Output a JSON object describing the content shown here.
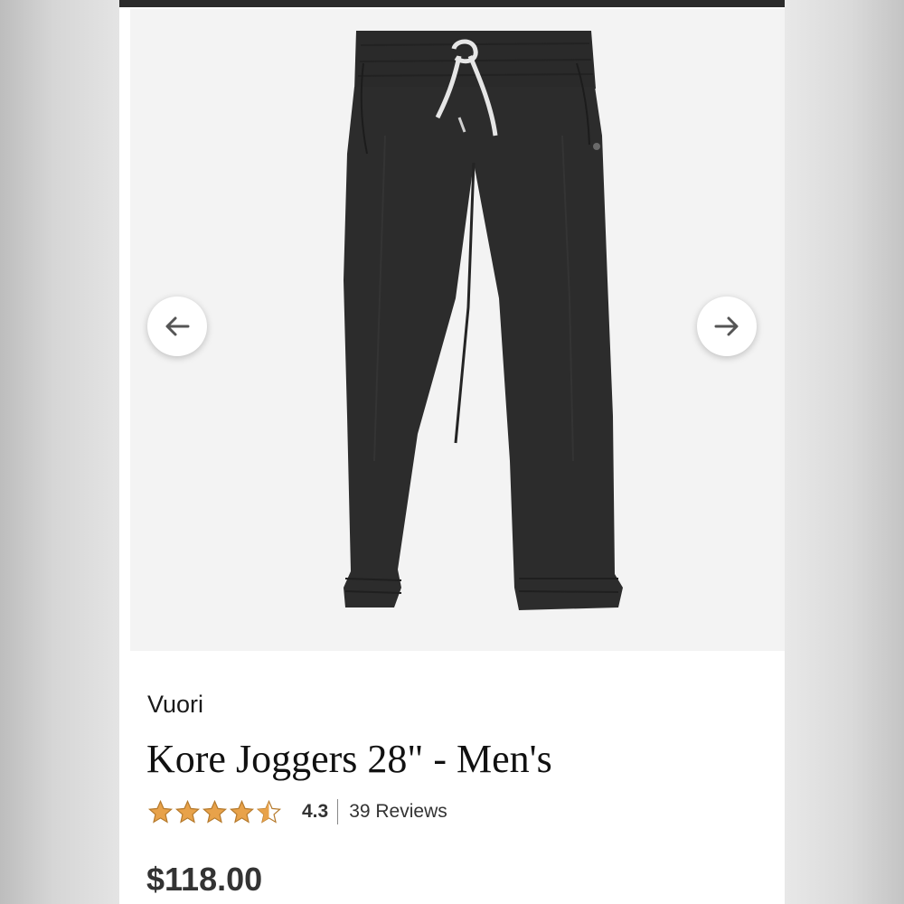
{
  "gallery": {
    "image_alt": "Black jogger pants with white drawstring",
    "prev_icon": "arrow-left-icon",
    "next_icon": "arrow-right-icon"
  },
  "product": {
    "brand": "Vuori",
    "title": "Kore Joggers 28\" - Men's",
    "rating": "4.3",
    "rating_stars": 4.3,
    "reviews": "39 Reviews",
    "price": "$118.00"
  },
  "colors": {
    "star": "#e8a24a",
    "star_outline": "#b67a2c",
    "pants": "#2b2b2b",
    "gallery_bg": "#f3f3f3"
  }
}
